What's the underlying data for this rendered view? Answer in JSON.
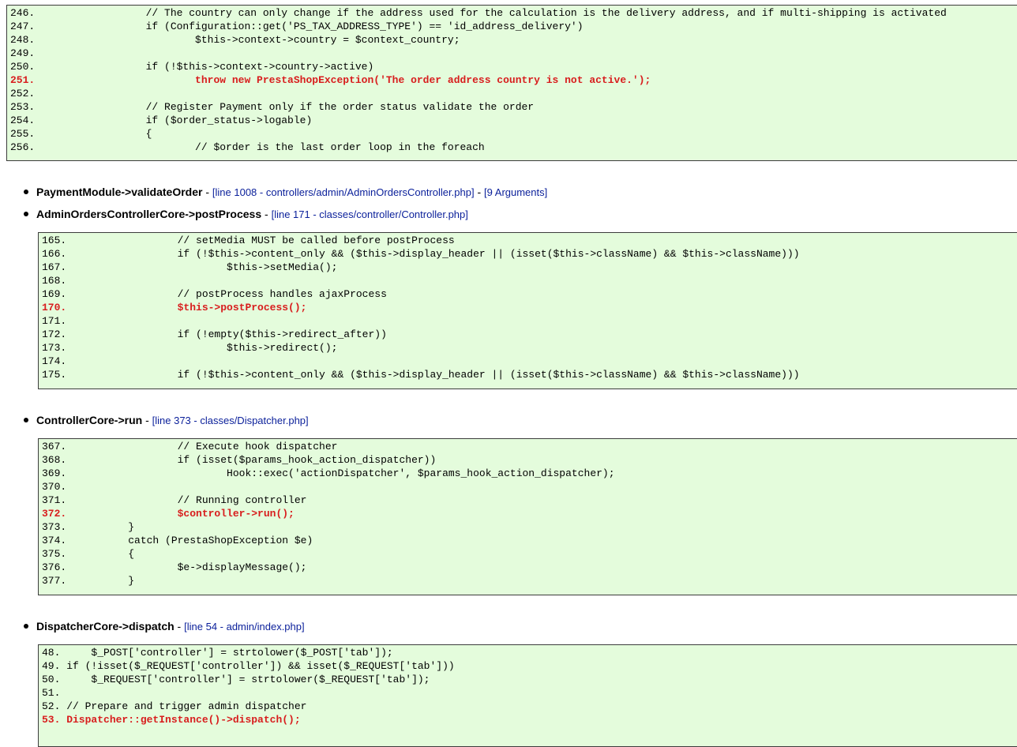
{
  "blocks": [
    {
      "id": "block1",
      "lines": [
        {
          "t": "246.                  // The country can only change if the address used for the calculation is the delivery address, and if multi-shipping is activated",
          "err": false
        },
        {
          "t": "247.                  if (Configuration::get('PS_TAX_ADDRESS_TYPE') == 'id_address_delivery')",
          "err": false
        },
        {
          "t": "248.                          $this->context->country = $context_country;",
          "err": false
        },
        {
          "t": "249.",
          "err": false
        },
        {
          "t": "250.                  if (!$this->context->country->active)",
          "err": false
        },
        {
          "t": "251.                          throw new PrestaShopException('The order address country is not active.');",
          "err": true
        },
        {
          "t": "252.",
          "err": false
        },
        {
          "t": "253.                  // Register Payment only if the order status validate the order",
          "err": false
        },
        {
          "t": "254.                  if ($order_status->logable)",
          "err": false
        },
        {
          "t": "255.                  {",
          "err": false
        },
        {
          "t": "256.                          // $order is the last order loop in the foreach",
          "err": false
        }
      ]
    },
    {
      "id": "block2",
      "lines": [
        {
          "t": "165.                  // setMedia MUST be called before postProcess",
          "err": false
        },
        {
          "t": "166.                  if (!$this->content_only && ($this->display_header || (isset($this->className) && $this->className)))",
          "err": false
        },
        {
          "t": "167.                          $this->setMedia();",
          "err": false
        },
        {
          "t": "168.",
          "err": false
        },
        {
          "t": "169.                  // postProcess handles ajaxProcess",
          "err": false
        },
        {
          "t": "170.                  $this->postProcess();",
          "err": true
        },
        {
          "t": "171.",
          "err": false
        },
        {
          "t": "172.                  if (!empty($this->redirect_after))",
          "err": false
        },
        {
          "t": "173.                          $this->redirect();",
          "err": false
        },
        {
          "t": "174.",
          "err": false
        },
        {
          "t": "175.                  if (!$this->content_only && ($this->display_header || (isset($this->className) && $this->className)))",
          "err": false
        }
      ]
    },
    {
      "id": "block3",
      "lines": [
        {
          "t": "367.                  // Execute hook dispatcher",
          "err": false
        },
        {
          "t": "368.                  if (isset($params_hook_action_dispatcher))",
          "err": false
        },
        {
          "t": "369.                          Hook::exec('actionDispatcher', $params_hook_action_dispatcher);",
          "err": false
        },
        {
          "t": "370.",
          "err": false
        },
        {
          "t": "371.                  // Running controller",
          "err": false
        },
        {
          "t": "372.                  $controller->run();",
          "err": true
        },
        {
          "t": "373.          }",
          "err": false
        },
        {
          "t": "374.          catch (PrestaShopException $e)",
          "err": false
        },
        {
          "t": "375.          {",
          "err": false
        },
        {
          "t": "376.                  $e->displayMessage();",
          "err": false
        },
        {
          "t": "377.          }",
          "err": false
        }
      ]
    },
    {
      "id": "block4",
      "lines": [
        {
          "t": "48.     $_POST['controller'] = strtolower($_POST['tab']);",
          "err": false
        },
        {
          "t": "49. if (!isset($_REQUEST['controller']) && isset($_REQUEST['tab']))",
          "err": false
        },
        {
          "t": "50.     $_REQUEST['controller'] = strtolower($_REQUEST['tab']);",
          "err": false
        },
        {
          "t": "51.",
          "err": false
        },
        {
          "t": "52. // Prepare and trigger admin dispatcher",
          "err": false
        },
        {
          "t": "53. Dispatcher::getInstance()->dispatch();",
          "err": true
        }
      ]
    }
  ],
  "traces": [
    {
      "fn": "PaymentModule->validateOrder",
      "sep": " - ",
      "loc": "[line 1008 - controllers/admin/AdminOrdersController.php]",
      "sep2": " - ",
      "args": "[9 Arguments]"
    },
    {
      "fn": "AdminOrdersControllerCore->postProcess",
      "sep": " - ",
      "loc": "[line 171 - classes/controller/Controller.php]"
    },
    {
      "fn": "ControllerCore->run",
      "sep": " - ",
      "loc": "[line 373 - classes/Dispatcher.php]"
    },
    {
      "fn": "DispatcherCore->dispatch",
      "sep": " - ",
      "loc": "[line 54 - admin/index.php]"
    }
  ]
}
